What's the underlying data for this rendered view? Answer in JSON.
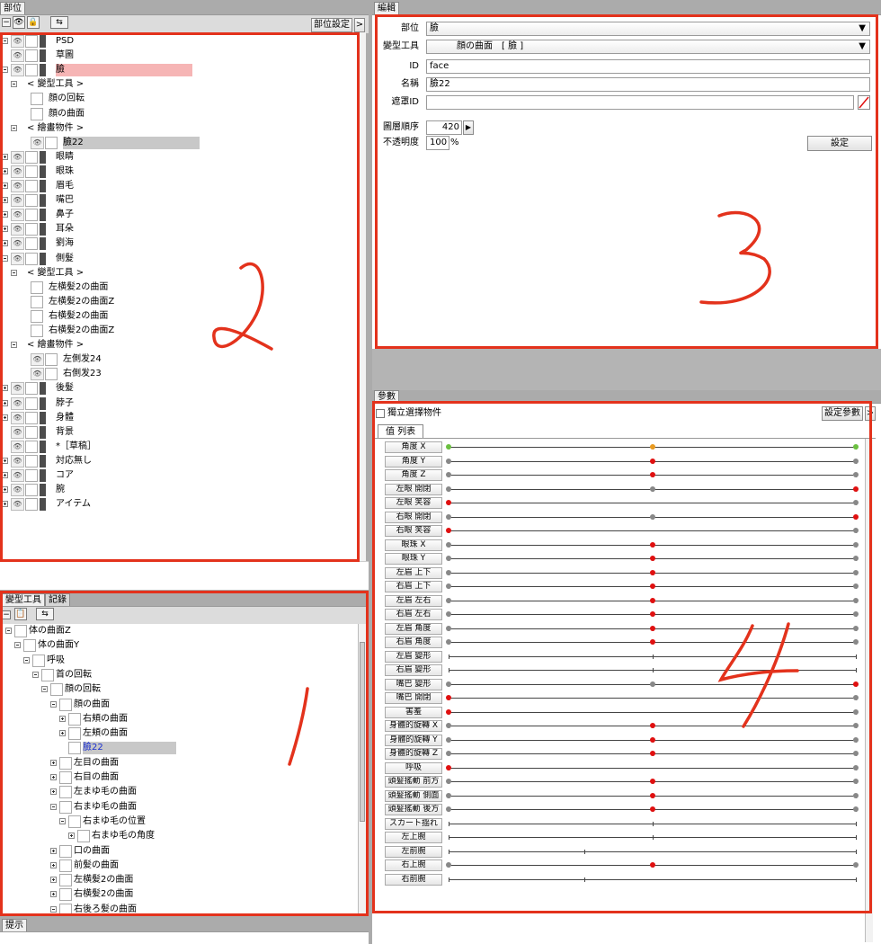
{
  "parts_panel": {
    "tab": "部位",
    "settings_button": "部位設定",
    "more_button": ">",
    "tree": [
      {
        "label": "PSD",
        "indent": 0,
        "expander": "minus",
        "type": "layer",
        "highlight": ""
      },
      {
        "label": "草圖",
        "indent": 0,
        "expander": "none",
        "type": "layer",
        "highlight": ""
      },
      {
        "label": "臉",
        "indent": 0,
        "expander": "minus",
        "type": "layer",
        "highlight": "red"
      },
      {
        "label": "< 變型工具 >",
        "indent": 1,
        "expander": "minus",
        "type": "group",
        "highlight": ""
      },
      {
        "label": "顔の回転",
        "indent": 2,
        "expander": "none",
        "type": "deformer",
        "highlight": ""
      },
      {
        "label": "顔の曲面",
        "indent": 2,
        "expander": "none",
        "type": "deformer",
        "highlight": ""
      },
      {
        "label": "< 繪畫物件 >",
        "indent": 1,
        "expander": "minus",
        "type": "group",
        "highlight": ""
      },
      {
        "label": "臉22",
        "indent": 2,
        "expander": "none",
        "type": "art",
        "highlight": "gray"
      },
      {
        "label": "眼睛",
        "indent": 0,
        "expander": "plus",
        "type": "layer",
        "highlight": ""
      },
      {
        "label": "眼珠",
        "indent": 0,
        "expander": "plus",
        "type": "layer",
        "highlight": ""
      },
      {
        "label": "眉毛",
        "indent": 0,
        "expander": "plus",
        "type": "layer",
        "highlight": ""
      },
      {
        "label": "嘴巴",
        "indent": 0,
        "expander": "plus",
        "type": "layer",
        "highlight": ""
      },
      {
        "label": "鼻子",
        "indent": 0,
        "expander": "plus",
        "type": "layer",
        "highlight": ""
      },
      {
        "label": "耳朵",
        "indent": 0,
        "expander": "plus",
        "type": "layer",
        "highlight": ""
      },
      {
        "label": "劉海",
        "indent": 0,
        "expander": "plus",
        "type": "layer",
        "highlight": ""
      },
      {
        "label": "側髮",
        "indent": 0,
        "expander": "minus",
        "type": "layer",
        "highlight": ""
      },
      {
        "label": "< 變型工具 >",
        "indent": 1,
        "expander": "minus",
        "type": "group",
        "highlight": ""
      },
      {
        "label": "左横髪2の曲面",
        "indent": 2,
        "expander": "none",
        "type": "deformer",
        "highlight": ""
      },
      {
        "label": "左横髪2の曲面Z",
        "indent": 2,
        "expander": "none",
        "type": "deformer",
        "highlight": ""
      },
      {
        "label": "右横髪2の曲面",
        "indent": 2,
        "expander": "none",
        "type": "deformer",
        "highlight": ""
      },
      {
        "label": "右横髪2の曲面Z",
        "indent": 2,
        "expander": "none",
        "type": "deformer",
        "highlight": ""
      },
      {
        "label": "< 繪畫物件 >",
        "indent": 1,
        "expander": "minus",
        "type": "group",
        "highlight": ""
      },
      {
        "label": "左側发24",
        "indent": 2,
        "expander": "none",
        "type": "art",
        "highlight": ""
      },
      {
        "label": "右側发23",
        "indent": 2,
        "expander": "none",
        "type": "art",
        "highlight": ""
      },
      {
        "label": "後髮",
        "indent": 0,
        "expander": "plus",
        "type": "layer",
        "highlight": ""
      },
      {
        "label": "脖子",
        "indent": 0,
        "expander": "plus",
        "type": "layer",
        "highlight": ""
      },
      {
        "label": "身體",
        "indent": 0,
        "expander": "plus",
        "type": "layer",
        "highlight": ""
      },
      {
        "label": "背景",
        "indent": 0,
        "expander": "none",
        "type": "layer",
        "highlight": ""
      },
      {
        "label": "*［草稿］",
        "indent": 0,
        "expander": "none",
        "type": "layer",
        "highlight": ""
      },
      {
        "label": "対応無し",
        "indent": 0,
        "expander": "plus",
        "type": "layer",
        "highlight": ""
      },
      {
        "label": "コア",
        "indent": 0,
        "expander": "plus",
        "type": "layer",
        "highlight": ""
      },
      {
        "label": "腕",
        "indent": 0,
        "expander": "plus",
        "type": "layer",
        "highlight": ""
      },
      {
        "label": "アイテム",
        "indent": 0,
        "expander": "plus",
        "type": "layer",
        "highlight": ""
      }
    ]
  },
  "deformer_panel": {
    "tabs": [
      "變型工具",
      "記錄"
    ],
    "tree": [
      {
        "label": "体の曲面Z",
        "indent": 0,
        "expander": "minus",
        "highlight": ""
      },
      {
        "label": "体の曲面Y",
        "indent": 1,
        "expander": "minus",
        "highlight": ""
      },
      {
        "label": "呼吸",
        "indent": 2,
        "expander": "minus",
        "highlight": ""
      },
      {
        "label": "首の回転",
        "indent": 3,
        "expander": "minus",
        "highlight": ""
      },
      {
        "label": "顔の回転",
        "indent": 4,
        "expander": "minus",
        "highlight": ""
      },
      {
        "label": "顔の曲面",
        "indent": 5,
        "expander": "minus",
        "highlight": ""
      },
      {
        "label": "右頬の曲面",
        "indent": 6,
        "expander": "plus",
        "highlight": ""
      },
      {
        "label": "左頬の曲面",
        "indent": 6,
        "expander": "plus",
        "highlight": ""
      },
      {
        "label": "臉22",
        "indent": 6,
        "expander": "none",
        "highlight": "blue"
      },
      {
        "label": "左目の曲面",
        "indent": 5,
        "expander": "plus",
        "highlight": ""
      },
      {
        "label": "右目の曲面",
        "indent": 5,
        "expander": "plus",
        "highlight": ""
      },
      {
        "label": "左まゆ毛の曲面",
        "indent": 5,
        "expander": "plus",
        "highlight": ""
      },
      {
        "label": "右まゆ毛の曲面",
        "indent": 5,
        "expander": "minus",
        "highlight": ""
      },
      {
        "label": "右まゆ毛の位置",
        "indent": 6,
        "expander": "minus",
        "highlight": ""
      },
      {
        "label": "右まゆ毛の角度",
        "indent": 7,
        "expander": "plus",
        "highlight": ""
      },
      {
        "label": "口の曲面",
        "indent": 5,
        "expander": "plus",
        "highlight": ""
      },
      {
        "label": "前髪の曲面",
        "indent": 5,
        "expander": "plus",
        "highlight": ""
      },
      {
        "label": "左横髪2の曲面",
        "indent": 5,
        "expander": "plus",
        "highlight": ""
      },
      {
        "label": "右横髪2の曲面",
        "indent": 5,
        "expander": "plus",
        "highlight": ""
      },
      {
        "label": "右後ろ髪の曲面",
        "indent": 5,
        "expander": "minus",
        "highlight": ""
      }
    ]
  },
  "hint_panel": {
    "tab": "提示"
  },
  "edit_panel": {
    "tab": "編輯",
    "part_label": "部位",
    "part_value": "臉",
    "deformer_label": "變型工具",
    "deformer_value": "顔の曲面　[ 臉 ]",
    "id_label": "ID",
    "id_value": "face",
    "name_label": "名稱",
    "name_value": "臉22",
    "mask_label": "遮罩ID",
    "mask_value": "",
    "order_label": "圖層順序",
    "order_value": "420",
    "opacity_label": "不透明度",
    "opacity_value": "100",
    "opacity_unit": "%",
    "settings_button": "設定"
  },
  "params_panel": {
    "tab": "參數",
    "checkbox_label": "獨立選擇物件",
    "settings_button": "設定參數",
    "more_button": ">",
    "list_tab": "值 列表",
    "params": [
      {
        "name": "角度 X",
        "knob": 0.5,
        "knob_color": "orange",
        "ticks": [
          0,
          0.5,
          1
        ],
        "end_colors": [
          "green",
          "green"
        ]
      },
      {
        "name": "角度 Y",
        "knob": 0.5,
        "knob_color": "red",
        "ticks": [
          0,
          0.5,
          1
        ],
        "end_colors": [
          "gray",
          "gray"
        ]
      },
      {
        "name": "角度 Z",
        "knob": 0.5,
        "knob_color": "red",
        "ticks": [
          0,
          0.5,
          1
        ],
        "end_colors": [
          "gray",
          "gray"
        ]
      },
      {
        "name": "左眼 開閉",
        "knob": 1.0,
        "knob_color": "red",
        "ticks": [
          0,
          0.5,
          1
        ],
        "end_colors": [
          "gray",
          "red"
        ],
        "mid_color": "gray"
      },
      {
        "name": "左眼 笑容",
        "knob": 0.0,
        "knob_color": "red",
        "ticks": [
          0,
          1
        ],
        "end_colors": [
          "red",
          "gray"
        ]
      },
      {
        "name": "右眼 開閉",
        "knob": 1.0,
        "knob_color": "red",
        "ticks": [
          0,
          0.5,
          1
        ],
        "end_colors": [
          "gray",
          "red"
        ],
        "mid_color": "gray"
      },
      {
        "name": "右眼 笑容",
        "knob": 0.0,
        "knob_color": "red",
        "ticks": [
          0,
          1
        ],
        "end_colors": [
          "red",
          "gray"
        ]
      },
      {
        "name": "眼珠 X",
        "knob": 0.5,
        "knob_color": "red",
        "ticks": [
          0,
          0.5,
          1
        ],
        "end_colors": [
          "gray",
          "gray"
        ]
      },
      {
        "name": "眼珠 Y",
        "knob": 0.5,
        "knob_color": "red",
        "ticks": [
          0,
          0.5,
          1
        ],
        "end_colors": [
          "gray",
          "gray"
        ]
      },
      {
        "name": "左眉 上下",
        "knob": 0.5,
        "knob_color": "red",
        "ticks": [
          0,
          0.5,
          1
        ],
        "end_colors": [
          "gray",
          "gray"
        ]
      },
      {
        "name": "右眉 上下",
        "knob": 0.5,
        "knob_color": "red",
        "ticks": [
          0,
          0.5,
          1
        ],
        "end_colors": [
          "gray",
          "gray"
        ]
      },
      {
        "name": "左眉 左右",
        "knob": 0.5,
        "knob_color": "red",
        "ticks": [
          0,
          0.5,
          1
        ],
        "end_colors": [
          "gray",
          "gray"
        ]
      },
      {
        "name": "右眉 左右",
        "knob": 0.5,
        "knob_color": "red",
        "ticks": [
          0,
          0.5,
          1
        ],
        "end_colors": [
          "gray",
          "gray"
        ]
      },
      {
        "name": "左眉 角度",
        "knob": 0.5,
        "knob_color": "red",
        "ticks": [
          0,
          0.5,
          1
        ],
        "end_colors": [
          "gray",
          "gray"
        ]
      },
      {
        "name": "右眉 角度",
        "knob": 0.5,
        "knob_color": "red",
        "ticks": [
          0,
          0.5,
          1
        ],
        "end_colors": [
          "gray",
          "gray"
        ]
      },
      {
        "name": "左眉 變形",
        "knob": null,
        "knob_color": "",
        "ticks": [
          0,
          0.5,
          1
        ],
        "end_colors": [
          "",
          ""
        ]
      },
      {
        "name": "右眉 變形",
        "knob": null,
        "knob_color": "",
        "ticks": [
          0,
          0.5,
          1
        ],
        "end_colors": [
          "",
          ""
        ]
      },
      {
        "name": "嘴巴 變形",
        "knob": 1.0,
        "knob_color": "red",
        "ticks": [
          0,
          0.5,
          1
        ],
        "end_colors": [
          "gray",
          "red"
        ],
        "mid_color": "gray"
      },
      {
        "name": "嘴巴 開閉",
        "knob": 0.0,
        "knob_color": "red",
        "ticks": [
          0,
          1
        ],
        "end_colors": [
          "red",
          "gray"
        ]
      },
      {
        "name": "害羞",
        "knob": 0.0,
        "knob_color": "red",
        "ticks": [
          0,
          1
        ],
        "end_colors": [
          "red",
          "gray"
        ]
      },
      {
        "name": "身體的旋轉 X",
        "knob": 0.5,
        "knob_color": "red",
        "ticks": [
          0,
          0.5,
          1
        ],
        "end_colors": [
          "gray",
          "gray"
        ]
      },
      {
        "name": "身體的旋轉 Y",
        "knob": 0.5,
        "knob_color": "red",
        "ticks": [
          0,
          0.5,
          1
        ],
        "end_colors": [
          "gray",
          "gray"
        ]
      },
      {
        "name": "身體的旋轉 Z",
        "knob": 0.5,
        "knob_color": "red",
        "ticks": [
          0,
          0.5,
          1
        ],
        "end_colors": [
          "gray",
          "gray"
        ]
      },
      {
        "name": "呼吸",
        "knob": 0.0,
        "knob_color": "red",
        "ticks": [
          0,
          1
        ],
        "end_colors": [
          "red",
          "gray"
        ]
      },
      {
        "name": "頭髮搖動 前方",
        "knob": 0.5,
        "knob_color": "red",
        "ticks": [
          0,
          0.5,
          1
        ],
        "end_colors": [
          "gray",
          "gray"
        ]
      },
      {
        "name": "頭髮搖動 側面",
        "knob": 0.5,
        "knob_color": "red",
        "ticks": [
          0,
          0.5,
          1
        ],
        "end_colors": [
          "gray",
          "gray"
        ]
      },
      {
        "name": "頭髮搖動 後方",
        "knob": 0.5,
        "knob_color": "red",
        "ticks": [
          0,
          0.5,
          1
        ],
        "end_colors": [
          "gray",
          "gray"
        ]
      },
      {
        "name": "スカート揺れ",
        "knob": null,
        "knob_color": "",
        "ticks": [
          0,
          0.5,
          1
        ],
        "end_colors": [
          "",
          ""
        ]
      },
      {
        "name": "左上腕",
        "knob": null,
        "knob_color": "",
        "ticks": [
          0,
          0.5,
          1
        ],
        "end_colors": [
          "",
          ""
        ]
      },
      {
        "name": "左前腕",
        "knob": null,
        "knob_color": "",
        "ticks": [
          0,
          0.333,
          1
        ],
        "end_colors": [
          "",
          ""
        ]
      },
      {
        "name": "右上腕",
        "knob": 0.5,
        "knob_color": "red",
        "ticks": [
          0,
          0.5,
          1
        ],
        "end_colors": [
          "gray",
          "gray"
        ]
      },
      {
        "name": "右前腕",
        "knob": null,
        "knob_color": "",
        "ticks": [
          0,
          0.333,
          1
        ],
        "end_colors": [
          "",
          ""
        ]
      }
    ]
  },
  "annotations": [
    "2",
    "1",
    "3",
    "4"
  ],
  "colors": {
    "red_frame": "#e3321c",
    "selected_red": "#f6b5b5",
    "selected_gray": "#c8c8c8",
    "knob_red": "#e01010",
    "knob_green": "#6bc040",
    "knob_orange": "#e89a20"
  }
}
